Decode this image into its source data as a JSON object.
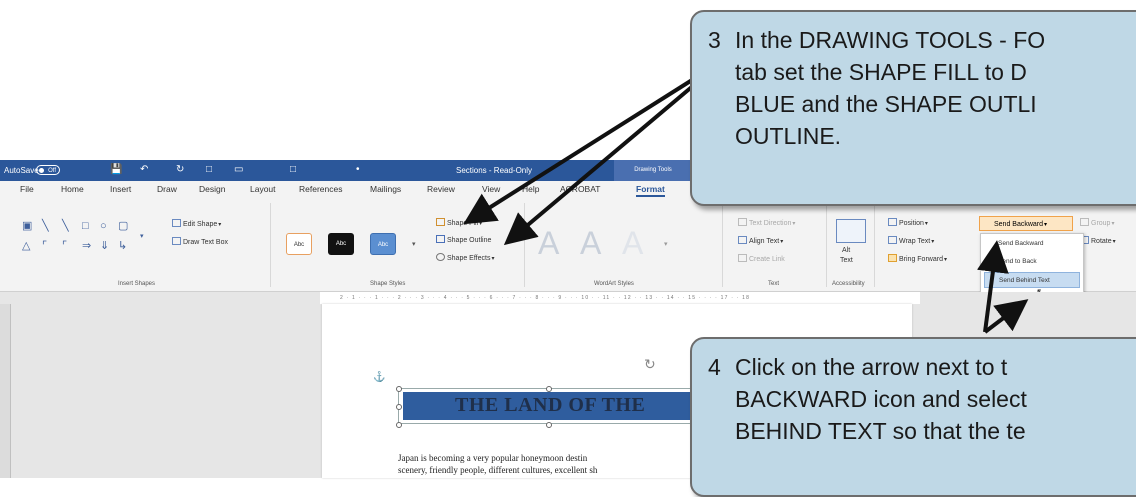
{
  "titlebar": {
    "autosave_label": "AutoSave",
    "autosave_state": "Off",
    "doc_title": "Sections - Read-Only",
    "drawing_tools": "Drawing Tools"
  },
  "tabs": [
    "File",
    "Home",
    "Insert",
    "Draw",
    "Design",
    "Layout",
    "References",
    "Mailings",
    "Review",
    "View",
    "Help",
    "ACROBAT",
    "Format"
  ],
  "ribbon": {
    "insert_shapes": {
      "edit_shape": "Edit Shape",
      "draw_text_box": "Draw Text Box",
      "group_label": "Insert Shapes"
    },
    "shape_styles": {
      "swatches": [
        "Abc",
        "Abc",
        "Abc"
      ],
      "shape_fill": "Shape Fill",
      "shape_outline": "Shape Outline",
      "shape_effects": "Shape Effects",
      "group_label": "Shape Styles"
    },
    "wordart": {
      "letters": [
        "A",
        "A",
        "A"
      ],
      "group_label": "WordArt Styles"
    },
    "text": {
      "text_direction": "Text Direction",
      "align_text": "Align Text",
      "create_link": "Create Link",
      "group_label": "Text"
    },
    "accessibility": {
      "alt_text_line1": "Alt",
      "alt_text_line2": "Text",
      "group_label": "Accessibility"
    },
    "arrange": {
      "position": "Position",
      "wrap_text": "Wrap Text",
      "bring_forward": "Bring Forward",
      "send_backward": "Send Backward",
      "group": "Group",
      "rotate": "Rotate"
    }
  },
  "send_menu": {
    "items": [
      "Send Backward",
      "Send to Back",
      "Send Behind Text"
    ],
    "highlighted_index": 2
  },
  "ruler": {
    "ticks": "2 · 1 · · · 1 · · · 2 · · · 3 · · · 4 · · · 5 · · · 6 · · · 7 · · · 8 · · · 9 · · · 10 · · 11 · · 12 · · 13 · · 14 · · 15 · · · · 17 · · 18"
  },
  "document": {
    "heading": "THE LAND OF THE",
    "body_lines": [
      "Japan is becoming a very popular honeymoon destin",
      "scenery, friendly people, different cultures, excellent sh"
    ]
  },
  "callouts": {
    "step3": {
      "number": "3",
      "lines": [
        "In the DRAWING TOOLS - FO",
        "tab set the SHAPE FILL to D",
        "BLUE and the SHAPE OUTLI",
        "OUTLINE."
      ]
    },
    "step4": {
      "number": "4",
      "lines": [
        "Click on the arrow next to t",
        "BACKWARD icon and select",
        "BEHIND TEXT so that the te"
      ]
    }
  },
  "colors": {
    "titlebar": "#2b579a",
    "callout_bg": "#bfd8e6",
    "banner_fill": "#2f5d9e"
  }
}
